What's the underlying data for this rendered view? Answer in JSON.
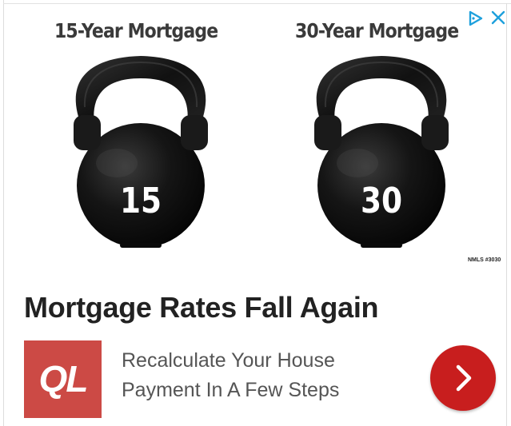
{
  "ad": {
    "image": {
      "left_heading": "15-Year Mortgage",
      "right_heading": "30-Year Mortgage",
      "left_weight_label": "15",
      "right_weight_label": "30",
      "nmls": "NMLS #3030"
    },
    "headline": "Mortgage Rates Fall Again",
    "logo_text": "QL",
    "description_line1": "Recalculate Your House",
    "description_line2": "Payment In A Few Steps",
    "icons": {
      "adchoices": "adchoices-icon",
      "close": "close-icon",
      "cta": "chevron-right-icon"
    },
    "colors": {
      "adchoices": "#1ea0dc",
      "logo_bg": "#cc4a45",
      "cta_bg": "#c81e1e",
      "headline": "#222222",
      "description": "#555555"
    }
  }
}
